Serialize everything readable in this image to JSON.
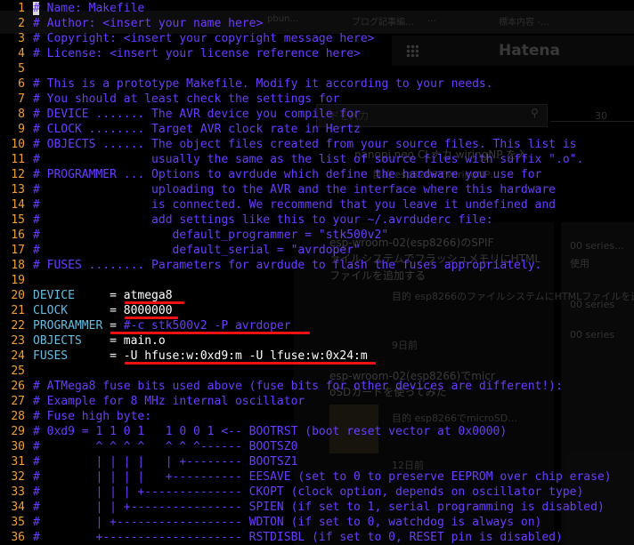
{
  "background_window": {
    "tabs": [
      "pbun...",
      "ブログ記事編…",
      "...",
      "標本内容 -…"
    ],
    "hatena_logo": "Hatena",
    "search_placeholder": "ドを入力",
    "ruler_label": "30",
    "entries": [
      {
        "title": "nanopi neo CLナカ wiringNP を入",
        "sub": "目的 esp8266でwiringNP…"
      },
      {
        "title": "esp-wroom-02(esp8266)のSPIF",
        "sub": "ァイルシステムでフラッシュメモリにHTML"
      },
      {
        "title": "ファイルを追加する",
        "sub": "目的 esp8266のファイルシステムにHTMLファイルを追加 ..."
      },
      {
        "title": "esp-wroom-02(esp8266)でmicr",
        "sub": "oSDカードを使ってみた"
      },
      {
        "title": "",
        "sub": "目的 esp8266でmicroSD…"
      }
    ],
    "dates": [
      "9日前",
      "12日前"
    ],
    "side_labels": [
      "00 series...",
      "使用",
      "00 series",
      "00 series"
    ]
  },
  "editor": {
    "lines": [
      {
        "n": "1",
        "t": "# Name: Makefile"
      },
      {
        "n": "2",
        "t": "# Author: <insert your name here>"
      },
      {
        "n": "3",
        "t": "# Copyright: <insert your copyright message here>"
      },
      {
        "n": "4",
        "t": "# License: <insert your license reference here>"
      },
      {
        "n": "5",
        "t": ""
      },
      {
        "n": "6",
        "t": "# This is a prototype Makefile. Modify it according to your needs."
      },
      {
        "n": "7",
        "t": "# You should at least check the settings for"
      },
      {
        "n": "8",
        "t": "# DEVICE ....... The AVR device you compile for"
      },
      {
        "n": "9",
        "t": "# CLOCK ........ Target AVR clock rate in Hertz"
      },
      {
        "n": "10",
        "t": "# OBJECTS ...... The object files created from your source files. This list is"
      },
      {
        "n": "11",
        "t": "#                usually the same as the list of source files with suffix \".o\"."
      },
      {
        "n": "12",
        "t": "# PROGRAMMER ... Options to avrdude which define the hardware you use for"
      },
      {
        "n": "13",
        "t": "#                uploading to the AVR and the interface where this hardware"
      },
      {
        "n": "14",
        "t": "#                is connected. We recommend that you leave it undefined and"
      },
      {
        "n": "15",
        "t": "#                add settings like this to your ~/.avrduderc file:"
      },
      {
        "n": "16",
        "t": "#                   default_programmer = \"stk500v2\""
      },
      {
        "n": "17",
        "t": "#                   default_serial = \"avrdoper\""
      },
      {
        "n": "18",
        "t": "# FUSES ........ Parameters for avrdude to flash the fuses appropriately."
      },
      {
        "n": "19",
        "t": ""
      },
      {
        "n": "20",
        "name": "DEVICE     ",
        "eq": "= ",
        "value": "atmega8"
      },
      {
        "n": "21",
        "name": "CLOCK      ",
        "eq": "= ",
        "value": "8000000"
      },
      {
        "n": "22",
        "name": "PROGRAMMER ",
        "eq": "= ",
        "value": "#-c stk500v2 -P avrdoper"
      },
      {
        "n": "23",
        "name": "OBJECTS    ",
        "eq": "= ",
        "value": "main.o"
      },
      {
        "n": "24",
        "name": "FUSES      ",
        "eq": "= ",
        "value": "-U hfuse:w:0xd9:m -U lfuse:w:0x24:m"
      },
      {
        "n": "25",
        "t": ""
      },
      {
        "n": "26",
        "t": "# ATMega8 fuse bits used above (fuse bits for other devices are different!):"
      },
      {
        "n": "27",
        "t": "# Example for 8 MHz internal oscillator"
      },
      {
        "n": "28",
        "t": "# Fuse high byte:"
      },
      {
        "n": "29",
        "t": "# 0xd9 = 1 1 0 1   1 0 0 1 <-- BOOTRST (boot reset vector at 0x0000)"
      },
      {
        "n": "30",
        "t": "#        ^ ^ ^ ^   ^ ^ ^------ BOOTSZ0"
      },
      {
        "n": "31",
        "t": "#        | | | |   | +-------- BOOTSZ1"
      },
      {
        "n": "32",
        "t": "#        | | | |   +---------- EESAVE (set to 0 to preserve EEPROM over chip erase)"
      },
      {
        "n": "33",
        "t": "#        | | | +-------------- CKOPT (clock option, depends on oscillator type)"
      },
      {
        "n": "34",
        "t": "#        | | +---------------- SPIEN (if set to 1, serial programming is disabled)"
      },
      {
        "n": "35",
        "t": "#        | +------------------ WDTON (if set to 0, watchdog is always on)"
      },
      {
        "n": "36",
        "t": "#        +-------------------- RSTDISBL (if set to 0, RESET pin is disabled)"
      }
    ]
  },
  "colors": {
    "line_number": "#f0a030",
    "comment": "#6a3cff",
    "identifier": "#66bde0",
    "value": "#ffffff",
    "highlight_underline": "#ee1111",
    "background": "#000000"
  }
}
